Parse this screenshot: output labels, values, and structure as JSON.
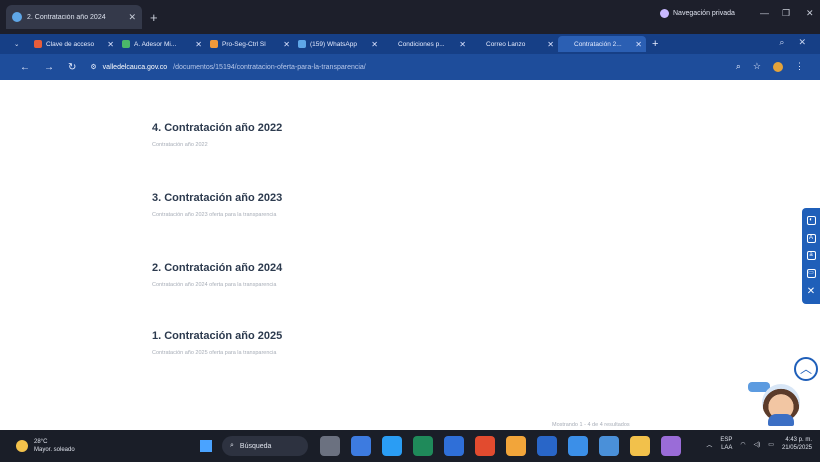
{
  "window": {
    "tab_title": "2. Contratación año 2024",
    "privacy_label": "Navegación privada"
  },
  "tabs": [
    {
      "label": "Clave de acceso",
      "color": "#e85d3a"
    },
    {
      "label": "A. Adesor Mi...",
      "color": "#f2c14b"
    },
    {
      "label": "Pro-Seg-Ctrl Sl",
      "color": "#4bb86a"
    },
    {
      "label": "(159) WhatsApp",
      "color": "#34c759"
    },
    {
      "label": "Condiciones p...",
      "color": "#f29a3a"
    },
    {
      "label": "Correo Lanzo",
      "color": "#3a8ee8"
    },
    {
      "label": "Contratación 2...",
      "color": "#5fa7e8"
    }
  ],
  "address": {
    "site": "valledelcauca.gov.co",
    "path": "/documentos/15194/contratacion-oferta-para-la-transparencia/"
  },
  "items": [
    {
      "title": "4. Contratación año 2022",
      "desc": "Contratación año 2022"
    },
    {
      "title": "3. Contratación año 2023",
      "desc": "Contratación año 2023 oferta para la transparencia"
    },
    {
      "title": "2. Contratación año 2024",
      "desc": "Contratación año 2024 oferta para la transparencia"
    },
    {
      "title": "1. Contratación año 2025",
      "desc": "Contratación año 2025 oferta para la transparencia"
    }
  ],
  "footer_note": "Mostrando 1 - 4 de 4 resultados",
  "taskbar": {
    "weather_temp": "28°C",
    "weather_desc": "Mayor. soleado",
    "search_label": "Búsqueda",
    "lang": "ESP",
    "lang_region": "LAA",
    "time": "4:43 p. m.",
    "date": "21/05/2025"
  }
}
